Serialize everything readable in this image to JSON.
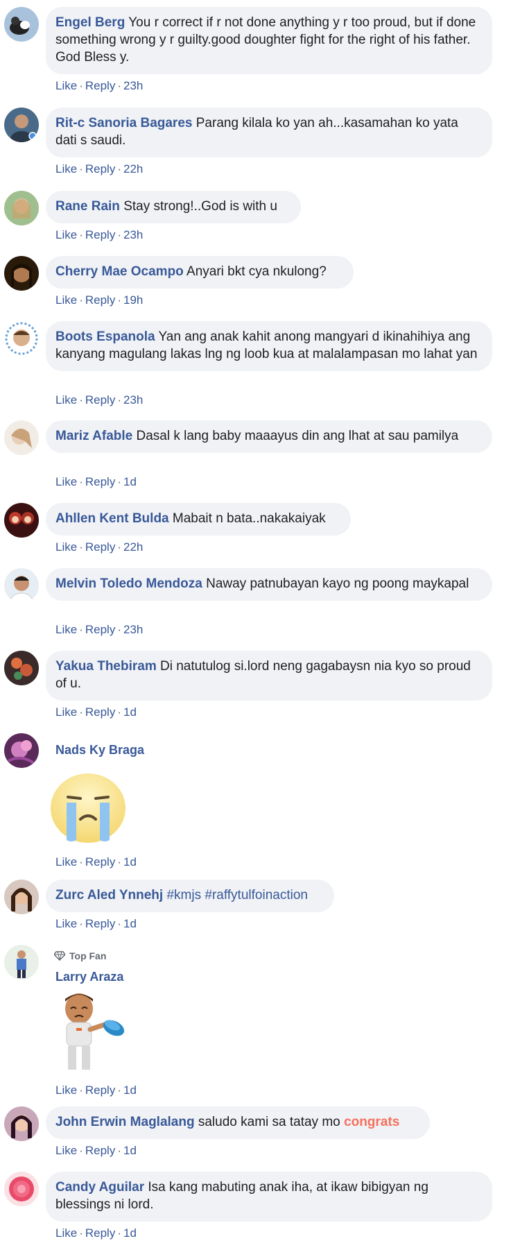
{
  "actions": {
    "like": "Like",
    "reply": "Reply",
    "sep": "·"
  },
  "colors": {
    "author": "#385898",
    "bubble": "#f0f2f5",
    "congrats": "#f7705d"
  },
  "comments": [
    {
      "author": "Engel Berg",
      "text": "You r correct if r not done anything y r too proud, but if done something wrong y r guilty.good doughter fight for the right of his father. God Bless y.",
      "time": "23h"
    },
    {
      "author": "Rit-c Sanoria Bagares",
      "text": "Parang kilala ko yan ah...kasamahan ko yata dati s saudi.",
      "time": "22h"
    },
    {
      "author": "Rane Rain",
      "text": "Stay strong!..God is with u",
      "time": "23h"
    },
    {
      "author": "Cherry Mae Ocampo",
      "text": "Anyari bkt cya nkulong?",
      "time": "19h"
    },
    {
      "author": "Boots Espanola",
      "text": "Yan ang anak kahit anong mangyari d ikinahihiya ang kanyang magulang lakas lng ng loob kua at malalampasan mo lahat yan",
      "time": "23h"
    },
    {
      "author": "Mariz Afable",
      "text": "Dasal k lang baby maaayus din ang lhat at sau pamilya",
      "time": "1d"
    },
    {
      "author": "Ahllen Kent Bulda",
      "text": "Mabait n bata..nakakaiyak",
      "time": "22h"
    },
    {
      "author": "Melvin Toledo Mendoza",
      "text": "Naway patnubayan kayo ng poong maykapal",
      "time": "23h"
    },
    {
      "author": "Yakua Thebiram",
      "text": "Di natutulog si.lord neng gagabaysn nia kyo so proud of u.",
      "time": "1d"
    },
    {
      "author": "Nads Ky Braga",
      "sticker": "crying-face-sticker",
      "time": "1d"
    },
    {
      "author": "Zurc Aled Ynnehj",
      "hashtags": "#kmjs #raffytulfoinaction",
      "time": "1d"
    },
    {
      "badge": "Top Fan",
      "author": "Larry Araza",
      "sticker": "crying-man-bowl-sticker",
      "time": "1d"
    },
    {
      "author": "John Erwin Maglalang",
      "text": "saludo kami sa tatay mo",
      "highlight": "congrats",
      "time": "1d"
    },
    {
      "author": "Candy Aguilar",
      "text": "Isa kang mabuting anak iha, at ikaw bibigyan ng blessings ni lord.",
      "time": "1d"
    }
  ]
}
